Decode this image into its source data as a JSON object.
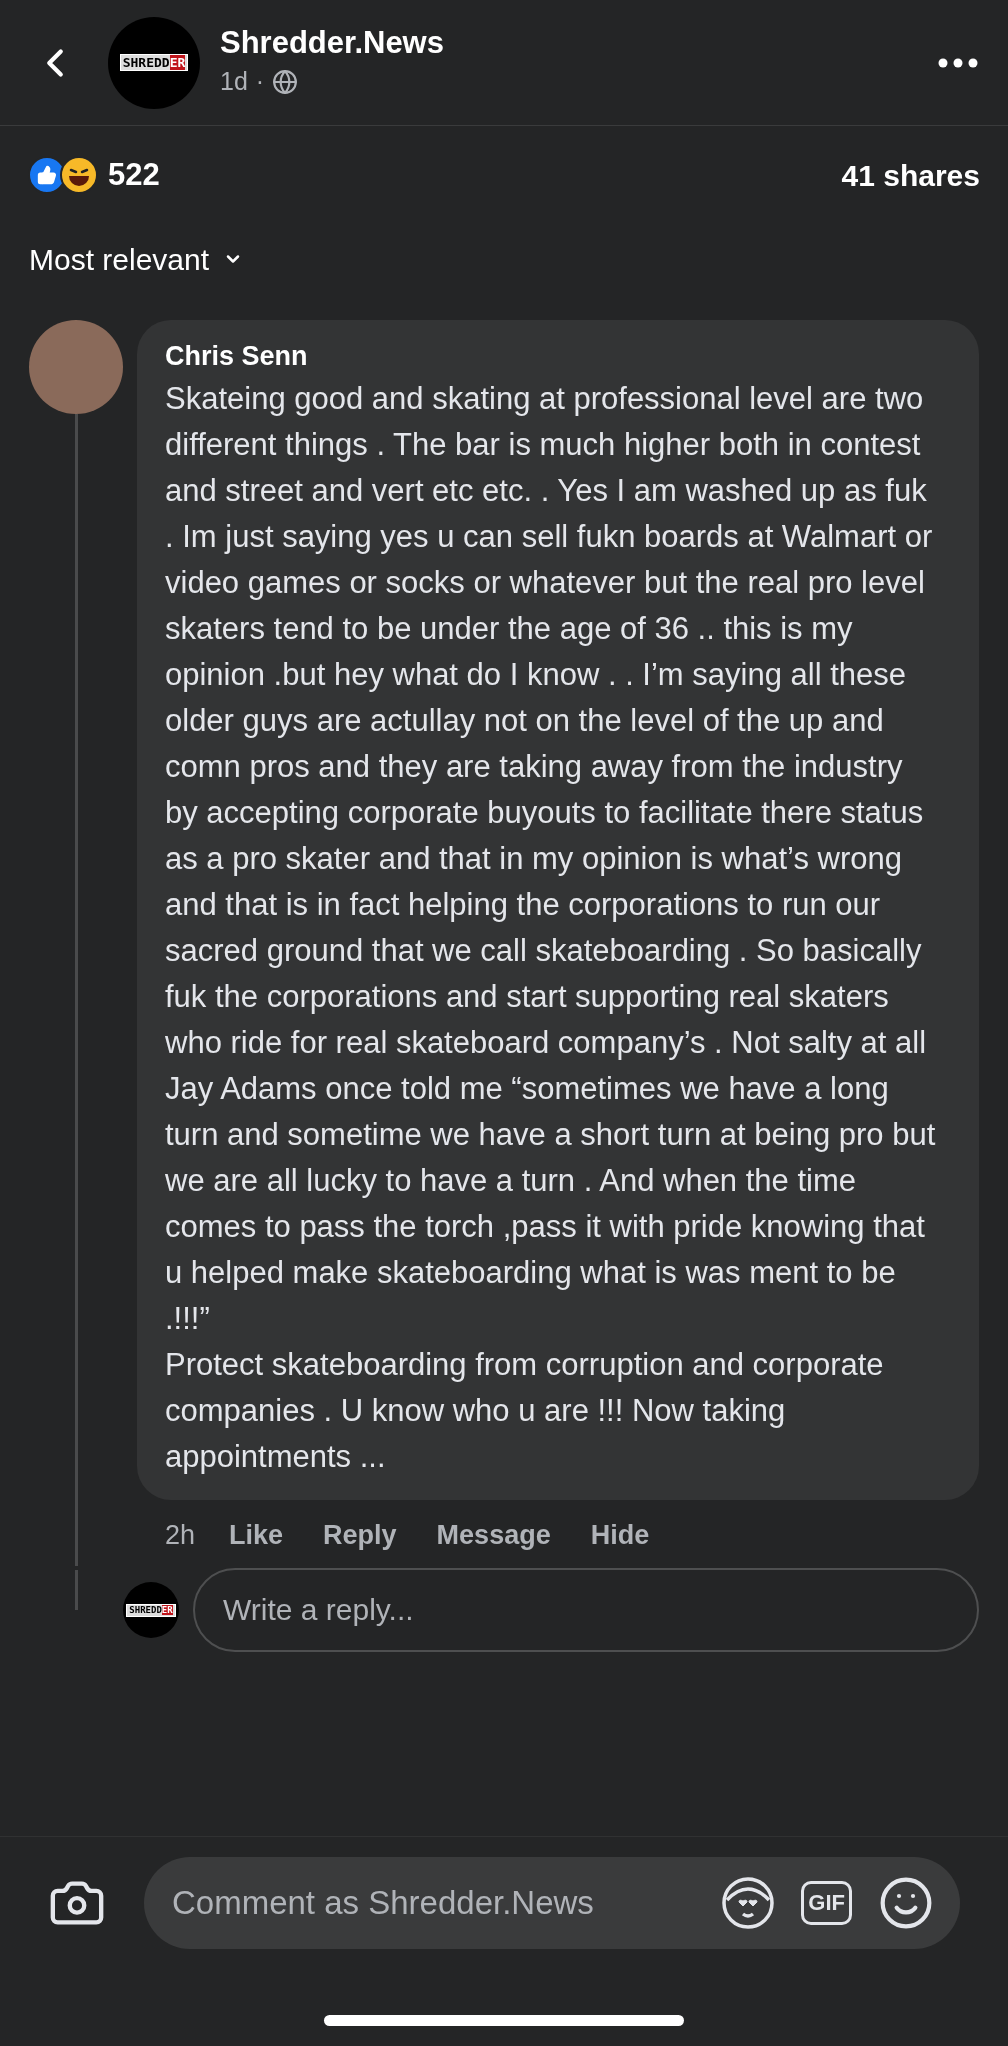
{
  "header": {
    "page_name": "Shredder.News",
    "logo_text": [
      "SHREDD",
      "ER"
    ],
    "age": "1d",
    "separator": "·"
  },
  "reactions": {
    "count": "522",
    "shares": "41 shares"
  },
  "sort": {
    "label": "Most relevant"
  },
  "comment": {
    "author": "Chris Senn",
    "text": "Skateing good and skating at professional level are two different things . The bar is much higher both in contest and street and vert etc etc. . Yes I am washed up as fuk . Im just saying yes u can sell fukn boards at Walmart or video games or socks or whatever but the real pro level skaters tend to be under the age of 36  .. this is my opinion .but hey what do I know . . I’m saying all these older guys are actullay not on the level of the up and comn pros and they are taking away from the industry by accepting corporate buyouts to facilitate there status as a pro skater and that in my opinion is what’s wrong and that is in fact helping the corporations to run our sacred ground that we call skateboarding . So basically fuk the corporations and start supporting real skaters who ride for real skateboard company’s  . Not salty at all\nJay Adams once told me “sometimes we have a long turn and sometime we have a short turn at being pro but we are all lucky to have a turn . And when the time comes to pass the torch ,pass it with pride knowing that u helped make skateboarding what is was ment to be .!!!”\nProtect skateboarding from corruption and corporate companies . U know who u are !!! Now taking appointments ...",
    "time": "2h",
    "actions": [
      "Like",
      "Reply",
      "Message",
      "Hide"
    ]
  },
  "reply_box": {
    "logo_text": [
      "SHREDD",
      "ER"
    ],
    "placeholder": "Write a reply..."
  },
  "composer": {
    "placeholder": "Comment as Shredder.News",
    "gif": "GIF"
  }
}
